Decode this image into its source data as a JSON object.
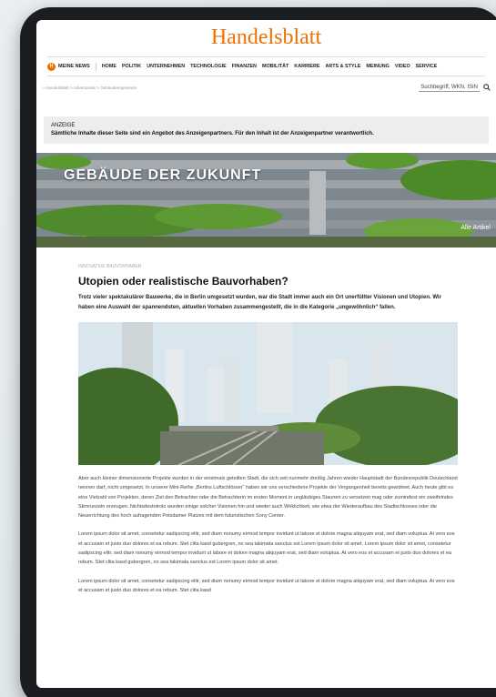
{
  "site": {
    "logo": "Handelsblatt"
  },
  "nav": {
    "badge": "H",
    "my_news": "MEINE NEWS",
    "items": [
      "HOME",
      "POLITIK",
      "UNTERNEHMEN",
      "TECHNOLOGIE",
      "FINANZEN",
      "MOBILITÄT",
      "KARRIERE",
      "ARTS & STYLE",
      "MEINUNG",
      "VIDEO",
      "SERVICE"
    ]
  },
  "breadcrumb": "Handelsblatt > Advertorials > Gebäudeingenieure",
  "search": {
    "placeholder": "Suchbegriff, WKN, ISIN"
  },
  "ad_notice": {
    "label": "ANZEIGE",
    "text": "Sämtliche Inhalte dieser Seite sind ein Angebot des Anzeigenpartners. Für den Inhalt ist der Anzeigenpartner verantwortlich."
  },
  "banner": {
    "title": "GEBÄUDE DER ZUKUNFT",
    "all_link": "Alle Artikel"
  },
  "article": {
    "kicker": "INNOVATIVE BAUVORHABEN",
    "headline": "Utopien oder realistische Bauvorhaben?",
    "lead": "Trotz vieler spektakulärer Bauwerke, die in Berlin umgesetzt wurden, war die Stadt immer auch ein Ort unerfüllter Visionen und Utopien. Wir haben eine Auswahl der spannendsten, aktuellen Vorhaben zusammengestellt, die in die Kategorie „ungewöhnlich“ fallen.",
    "paragraphs": [
      "Aber auch kleiner dimensionierte Projekte wurden in der einstmals geteilten Stadt, die sich seit nunmehr dreißig Jahren wieder Hauptstadt der Bundesrepublik Deutschland nennen darf, nicht umgesetzt. In unserer Mini-Reihe „Berlins Luftschlösser“ haben wir uns verschiedene Projekte der Vergangenheit bereits gewidmet. Auch heute gibt es eine Vielzahl von Projekten, deren Ziel den Betrachter oder die Betrachterin im ersten Moment in ungläubiges Staunen zu versetzen mag oder zumindest ein zweifelndes Stirnrunzeln erzeugen. Nichtsdestotrotz wurden einige solcher Visionen hin und wieder auch Wirklichkeit, wie etwa der Wiederaufbau des Stadtschlosses oder die Neuerrichtung des hoch aufragenden Potsdamer Platzes mit dem futuristischen Sony Center.",
      "Lorem ipsum dolor sit amet, consetetur sadipscing elitr, sed diam nonumy eirmod tempor invidunt ut labore et dolore magna aliquyam erat, sed diam voluptua. At vero eos et accusam et justo duo dolores et ea rebum. Stet clita kasd gubergren, no sea takimata sanctus est Lorem ipsum dolor sit amet. Lorem ipsum dolor sit amet, consetetur sadipscing elitr, sed diam nonumy eirmod tempor invidunt ut labore et dolore magna aliquyam erat, sed diam voluptua. At vero eos et accusam et justo duo dolores et ea rebum. Stet clita kasd gubergren, no sea takimata sanctus est Lorem ipsum dolor sit amet.",
      "Lorem ipsum dolor sit amet, consetetur sadipscing elitr, sed diam nonumy eirmod tempor invidunt ut labore et dolore magna aliquyam erat, sed diam voluptua. At vero eos et accusam et justo duo dolores et ea rebum. Stet clita kasd"
    ]
  },
  "colors": {
    "brand": "#ee7000",
    "device": "#1b1d20"
  }
}
